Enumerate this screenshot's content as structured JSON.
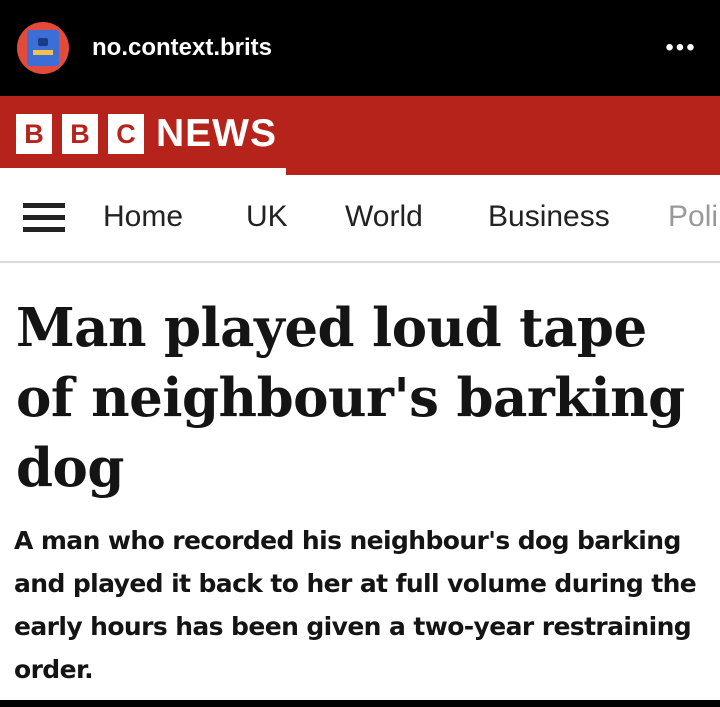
{
  "post": {
    "username": "no.context.brits",
    "more_icon": "more-horizontal-icon"
  },
  "bbc": {
    "logo_letters": [
      "B",
      "B",
      "C"
    ],
    "news_word": "NEWS",
    "brand_color": "#b6231a"
  },
  "nav": {
    "menu_icon": "hamburger-menu-icon",
    "items": [
      "Home",
      "UK",
      "World",
      "Business",
      "Poli"
    ]
  },
  "article": {
    "headline": "Man played loud tape of neighbour's barking dog",
    "summary": "A man who recorded his neighbour's dog barking and played it back to her at full volume during the early hours has been given a two-year restraining order."
  }
}
